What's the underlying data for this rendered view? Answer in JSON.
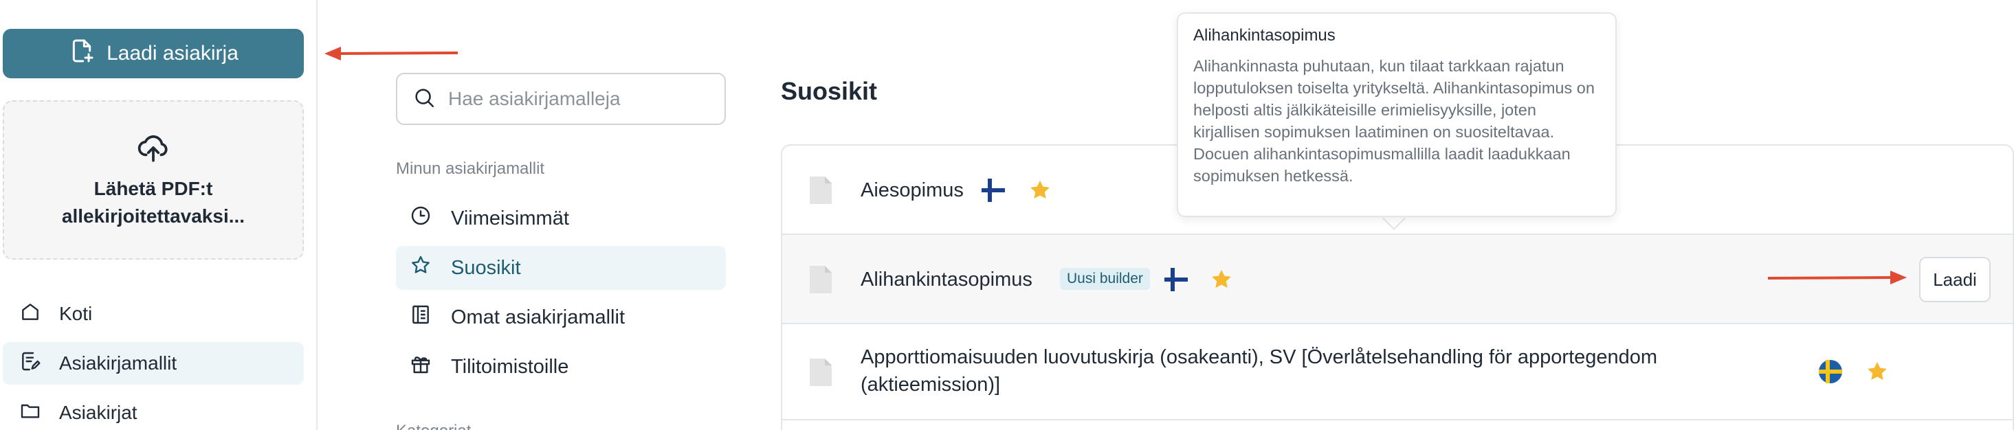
{
  "sidebar": {
    "create_button": "Laadi asiakirja",
    "upload_text": "Lähetä PDF:t\nallekirjoitettavaksi...",
    "items": [
      {
        "label": "Koti",
        "icon": "home-icon",
        "active": false
      },
      {
        "label": "Asiakirjamallit",
        "icon": "template-icon",
        "active": true
      },
      {
        "label": "Asiakirjat",
        "icon": "folder-icon",
        "active": false
      }
    ]
  },
  "templates_nav": {
    "search_placeholder": "Hae asiakirjamalleja",
    "section_label": "Minun asiakirjamallit",
    "items": [
      {
        "label": "Viimeisimmät",
        "icon": "clock-icon",
        "active": false
      },
      {
        "label": "Suosikit",
        "icon": "star-outline-icon",
        "active": true
      },
      {
        "label": "Omat asiakirjamallit",
        "icon": "book-icon",
        "active": false
      },
      {
        "label": "Tilitoimistoille",
        "icon": "gift-icon",
        "active": false
      }
    ],
    "section_label_2": "Kategoriat"
  },
  "main": {
    "heading": "Suosikit",
    "rows": [
      {
        "title": "Aiesopimus",
        "badge": "",
        "flag": "fi-flag-icon",
        "favorite": true
      },
      {
        "title": "Alihankintasopimus",
        "badge": "Uusi builder",
        "flag": "fi-flag-icon",
        "favorite": true,
        "button": "Laadi"
      },
      {
        "title": "Apporttiomaisuuden luovutuskirja (osakeanti), SV [Överlåtelsehandling för apportegendom (aktieemission)]",
        "badge": "",
        "flag": "se-flag-icon",
        "favorite": true
      }
    ]
  },
  "tooltip": {
    "title": "Alihankintasopimus",
    "body": "Alihankinnasta puhutaan, kun tilaat tarkkaan rajatun lopputuloksen toiselta yritykseltä. Alihankintasopimus on helposti altis jälkikäteisille erimielisyyksille, joten kirjallisen sopimuksen laatiminen on suositeltavaa. Docuen alihankintasopimusmallilla laadit laadukkaan sopimuksen hetkessä."
  },
  "colors": {
    "primary": "#3e7a90",
    "active_bg": "#edf5f8",
    "star": "#f5b82e",
    "annotation_arrow": "#e04a32"
  }
}
